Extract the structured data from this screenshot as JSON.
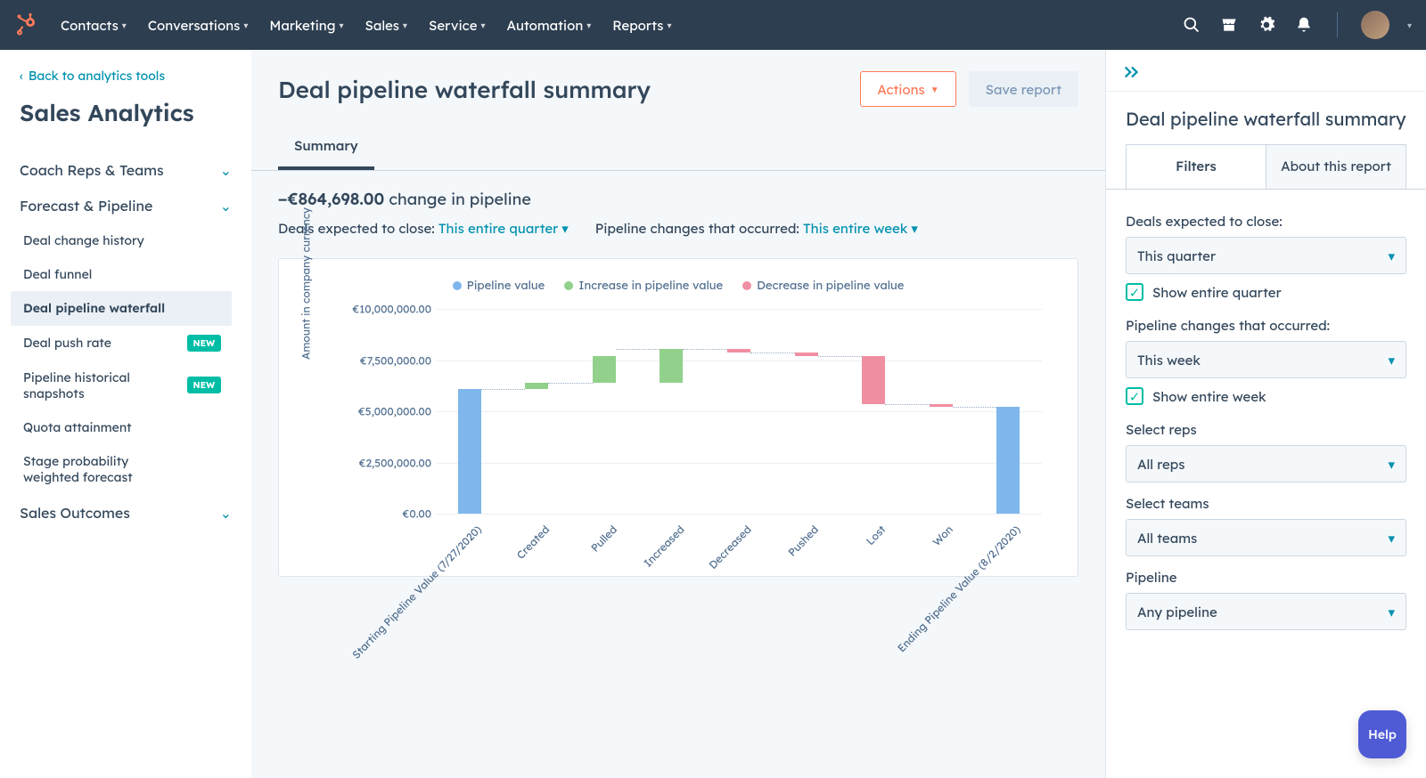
{
  "colors": {
    "blue": "#7fb6ec",
    "green": "#91d18b",
    "pink": "#f08fa2",
    "teal": "#0091ae"
  },
  "topbar": {
    "nav": [
      "Contacts",
      "Conversations",
      "Marketing",
      "Sales",
      "Service",
      "Automation",
      "Reports"
    ]
  },
  "sidebar": {
    "back_label": "Back to analytics tools",
    "title": "Sales Analytics",
    "groups": [
      {
        "label": "Coach Reps & Teams",
        "open": false,
        "items": []
      },
      {
        "label": "Forecast & Pipeline",
        "open": true,
        "items": [
          {
            "label": "Deal change history"
          },
          {
            "label": "Deal funnel"
          },
          {
            "label": "Deal pipeline waterfall",
            "active": true
          },
          {
            "label": "Deal push rate",
            "badge": "NEW"
          },
          {
            "label": "Pipeline historical snapshots",
            "badge": "NEW"
          },
          {
            "label": "Quota attainment"
          },
          {
            "label": "Stage probability weighted forecast"
          }
        ]
      },
      {
        "label": "Sales Outcomes",
        "open": false,
        "items": []
      }
    ]
  },
  "main": {
    "title": "Deal pipeline waterfall summary",
    "actions_label": "Actions",
    "save_label": "Save report",
    "tabs": [
      "Summary"
    ],
    "change_value": "−€864,698.00",
    "change_suffix": " change in pipeline",
    "filter1_label": "Deals expected to close: ",
    "filter1_value": "This entire quarter",
    "filter2_label": "Pipeline changes that occurred: ",
    "filter2_value": "This entire week"
  },
  "legend": [
    {
      "label": "Pipeline value",
      "color": "#7fb6ec"
    },
    {
      "label": "Increase in pipeline value",
      "color": "#91d18b"
    },
    {
      "label": "Decrease in pipeline value",
      "color": "#f08fa2"
    }
  ],
  "right_panel": {
    "title": "Deal pipeline waterfall summary",
    "tabs": [
      "Filters",
      "About this report"
    ],
    "filters": {
      "close_label": "Deals expected to close:",
      "close_value": "This quarter",
      "close_checkbox": "Show entire quarter",
      "changes_label": "Pipeline changes that occurred:",
      "changes_value": "This week",
      "changes_checkbox": "Show entire week",
      "reps_label": "Select reps",
      "reps_value": "All reps",
      "teams_label": "Select teams",
      "teams_value": "All teams",
      "pipeline_label": "Pipeline",
      "pipeline_value": "Any pipeline"
    }
  },
  "help": "Help",
  "chart_data": {
    "type": "bar",
    "title": "",
    "xlabel": "",
    "ylabel": "Amount in company currency",
    "ylim": [
      0,
      10000000
    ],
    "yticks": [
      "€0.00",
      "€2,500,000.00",
      "€5,000,000.00",
      "€7,500,000.00",
      "€10,000,000.00"
    ],
    "categories": [
      "Starting Pipeline Value (7/27/2020)",
      "Created",
      "Pulled",
      "Increased",
      "Decreased",
      "Pushed",
      "Lost",
      "Won",
      "Ending Pipeline Value (8/2/2020)"
    ],
    "series": [
      {
        "name": "Pipeline value",
        "color": "#7fb6ec",
        "bottom": [
          0,
          null,
          null,
          null,
          null,
          null,
          null,
          null,
          0
        ],
        "top": [
          6100000,
          null,
          null,
          null,
          null,
          null,
          null,
          null,
          5235302
        ]
      },
      {
        "name": "Increase in pipeline value",
        "color": "#91d18b",
        "bottom": [
          null,
          6100000,
          6400000,
          6400000,
          null,
          null,
          null,
          null,
          null
        ],
        "top": [
          null,
          6400000,
          7700000,
          8050000,
          null,
          null,
          null,
          null,
          null
        ]
      },
      {
        "name": "Decrease in pipeline value",
        "color": "#f08fa2",
        "bottom": [
          null,
          null,
          null,
          null,
          7850000,
          7700000,
          5350000,
          5235302,
          null
        ],
        "top": [
          null,
          null,
          null,
          null,
          8050000,
          7850000,
          7700000,
          5350000,
          null
        ]
      }
    ]
  }
}
